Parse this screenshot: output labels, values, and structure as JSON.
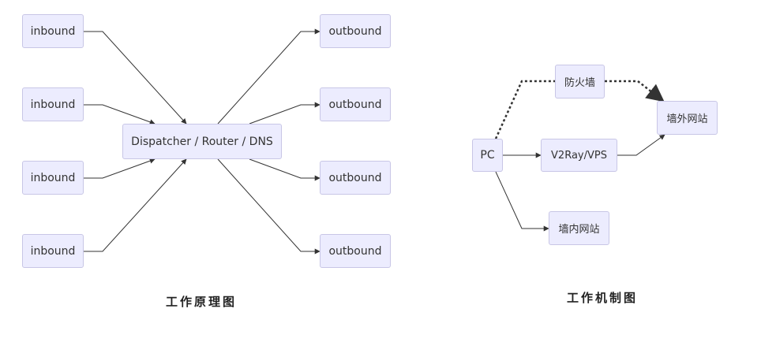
{
  "left_diagram": {
    "inbounds": [
      "inbound",
      "inbound",
      "inbound",
      "inbound"
    ],
    "center": "Dispatcher / Router / DNS",
    "outbounds": [
      "outbound",
      "outbound",
      "outbound",
      "outbound"
    ],
    "caption": "工作原理图"
  },
  "right_diagram": {
    "pc": "PC",
    "firewall": "防火墙",
    "proxy": "V2Ray/VPS",
    "outside_site": "墙外网站",
    "inside_site": "墙内网站",
    "caption": "工作机制图"
  }
}
